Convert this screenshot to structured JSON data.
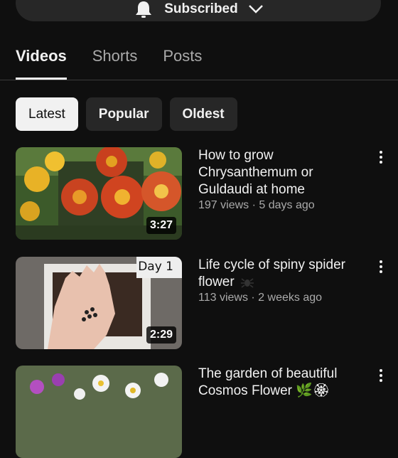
{
  "subscribe": {
    "label": "Subscribed"
  },
  "tabs": [
    {
      "label": "Videos"
    },
    {
      "label": "Shorts"
    },
    {
      "label": "Posts"
    }
  ],
  "chips": [
    {
      "label": "Latest"
    },
    {
      "label": "Popular"
    },
    {
      "label": "Oldest"
    }
  ],
  "videos": [
    {
      "title": "How to grow Chrysanthemum or Guldaudi at home",
      "meta": "197 views · 5 days ago",
      "duration": "3:27"
    },
    {
      "title": "Life cycle of spiny spider flower",
      "meta": "113 views · 2 weeks ago",
      "duration": "2:29",
      "overlay_text": "Day 1"
    },
    {
      "title": "The garden of beautiful Cosmos Flower 🌿🏵",
      "meta": "",
      "duration": ""
    }
  ],
  "colors": {
    "background": "#0f0f0f",
    "chip": "#272727",
    "chip_selected": "#f1f1f1",
    "muted_text": "#aaaaaa"
  }
}
